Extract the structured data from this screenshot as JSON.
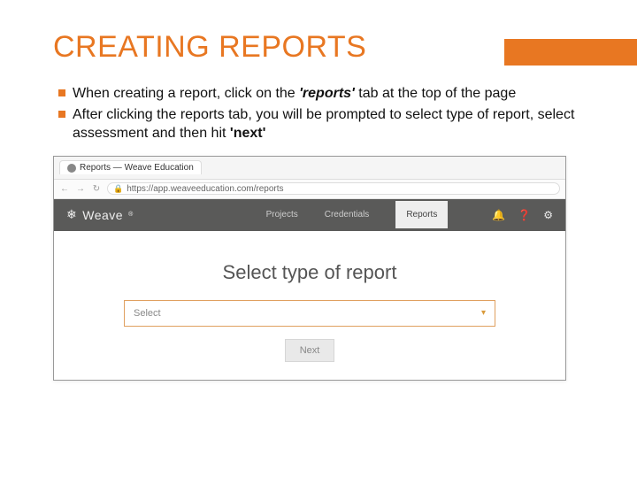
{
  "slide": {
    "title": "CREATING REPORTS",
    "bullets": [
      {
        "pre": "When creating a report, click on the ",
        "em": "'reports'",
        "post": " tab at the top of the page"
      },
      {
        "pre": "After clicking the reports tab, you will be prompted to select type of report, select assessment and then hit ",
        "em": "'next'",
        "post": ""
      }
    ]
  },
  "screenshot": {
    "tab_title": "Reports — Weave Education",
    "url": "https://app.weaveeducation.com/reports",
    "brand": "Weave",
    "nav": {
      "projects": "Projects",
      "credentials": "Credentials",
      "reports": "Reports"
    },
    "page_heading": "Select type of report",
    "select_placeholder": "Select",
    "next_label": "Next"
  }
}
